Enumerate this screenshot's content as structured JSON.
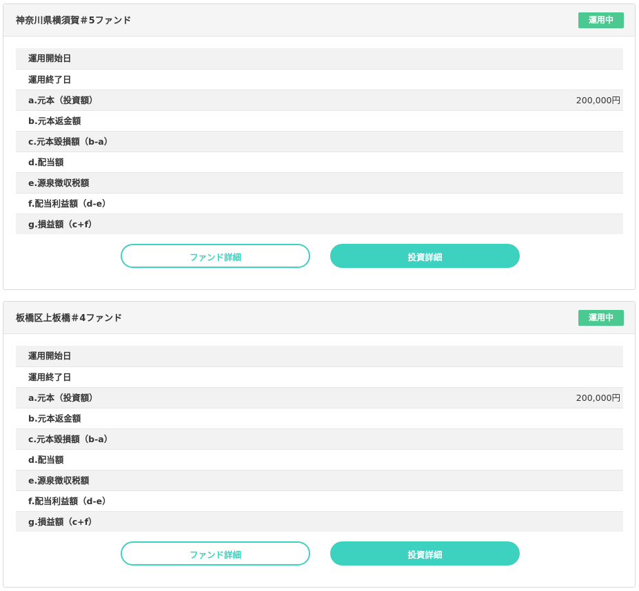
{
  "colors": {
    "accent": "#3dd1bf",
    "badge": "#4cc990"
  },
  "funds": [
    {
      "title": "神奈川県横須賀＃5ファンド",
      "status": "運用中",
      "rows": [
        {
          "label": "運用開始日",
          "value": ""
        },
        {
          "label": "運用終了日",
          "value": ""
        },
        {
          "label": "a.元本（投資額）",
          "value": "200,000円"
        },
        {
          "label": "b.元本返金額",
          "value": ""
        },
        {
          "label": "c.元本毀損額（b-a）",
          "value": ""
        },
        {
          "label": "d.配当額",
          "value": ""
        },
        {
          "label": "e.源泉徴収税額",
          "value": ""
        },
        {
          "label": "f.配当利益額（d-e）",
          "value": ""
        },
        {
          "label": "g.損益額（c+f）",
          "value": ""
        }
      ],
      "fund_detail_label": "ファンド詳細",
      "investment_detail_label": "投資詳細"
    },
    {
      "title": "板橋区上板橋＃4ファンド",
      "status": "運用中",
      "rows": [
        {
          "label": "運用開始日",
          "value": ""
        },
        {
          "label": "運用終了日",
          "value": ""
        },
        {
          "label": "a.元本（投資額）",
          "value": "200,000円"
        },
        {
          "label": "b.元本返金額",
          "value": ""
        },
        {
          "label": "c.元本毀損額（b-a）",
          "value": ""
        },
        {
          "label": "d.配当額",
          "value": ""
        },
        {
          "label": "e.源泉徴収税額",
          "value": ""
        },
        {
          "label": "f.配当利益額（d-e）",
          "value": ""
        },
        {
          "label": "g.損益額（c+f）",
          "value": ""
        }
      ],
      "fund_detail_label": "ファンド詳細",
      "investment_detail_label": "投資詳細"
    }
  ]
}
